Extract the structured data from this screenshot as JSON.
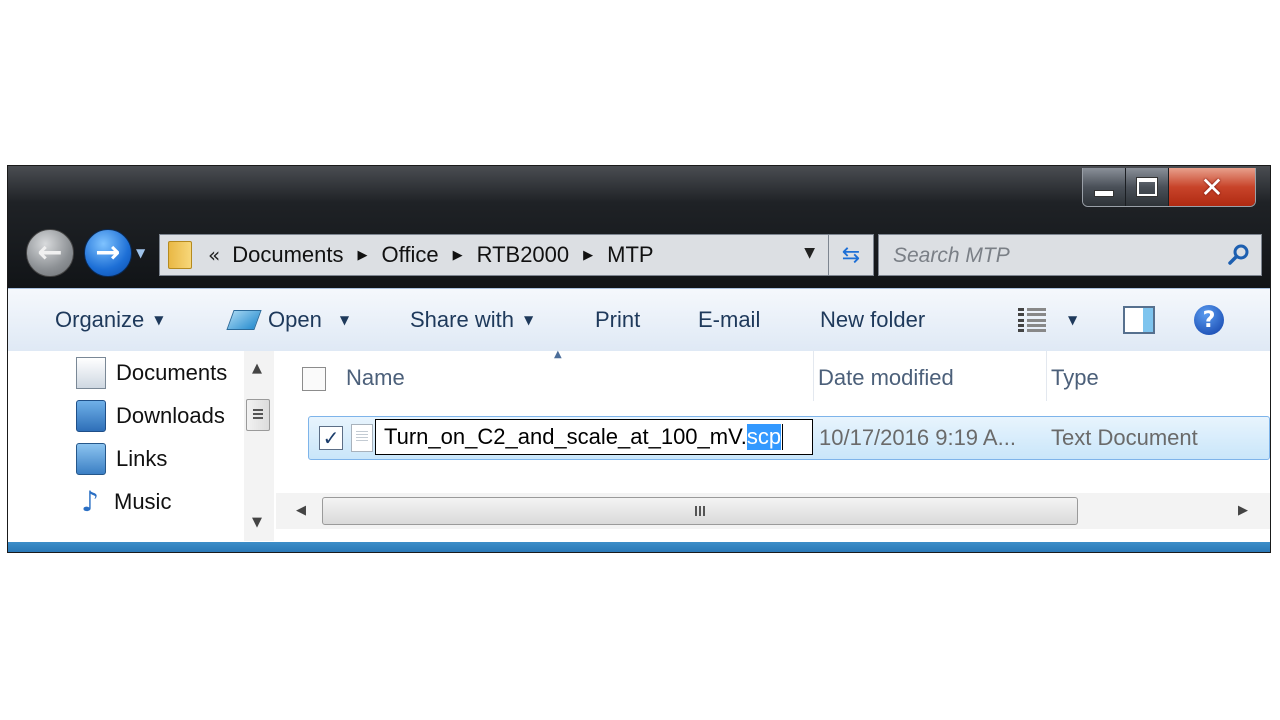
{
  "window": {
    "caption": {
      "minimize": "minimize",
      "maximize": "maximize",
      "close": "close"
    }
  },
  "navigation": {
    "back_icon": "back-arrow-icon",
    "forward_icon": "forward-arrow-icon"
  },
  "address_bar": {
    "overflow": "«",
    "crumbs": [
      "Documents",
      "Office",
      "RTB2000",
      "MTP"
    ]
  },
  "search": {
    "placeholder": "Search MTP"
  },
  "toolbar": {
    "organize": "Organize",
    "open": "Open",
    "share_with": "Share with",
    "print": "Print",
    "email": "E-mail",
    "new_folder": "New folder",
    "help": "?"
  },
  "sidebar": {
    "items": [
      {
        "label": "Documents",
        "icon": "documents-icon"
      },
      {
        "label": "Downloads",
        "icon": "downloads-icon"
      },
      {
        "label": "Links",
        "icon": "links-icon"
      },
      {
        "label": "Music",
        "icon": "music-icon"
      }
    ]
  },
  "file_list": {
    "columns": {
      "name": "Name",
      "date_modified": "Date modified",
      "type": "Type"
    },
    "rows": [
      {
        "checked": true,
        "name_base": "Turn_on_C2_and_scale_at_100_mV.",
        "name_ext_selected": "scp",
        "date_modified": "10/17/2016 9:19 A...",
        "type": "Text Document"
      }
    ]
  },
  "colors": {
    "title_bar": "#1a1d21",
    "toolbar": "#dfe9f5",
    "selection": "#3399ff",
    "row_highlight": "#c9e6fa",
    "close_button": "#c8442a"
  }
}
